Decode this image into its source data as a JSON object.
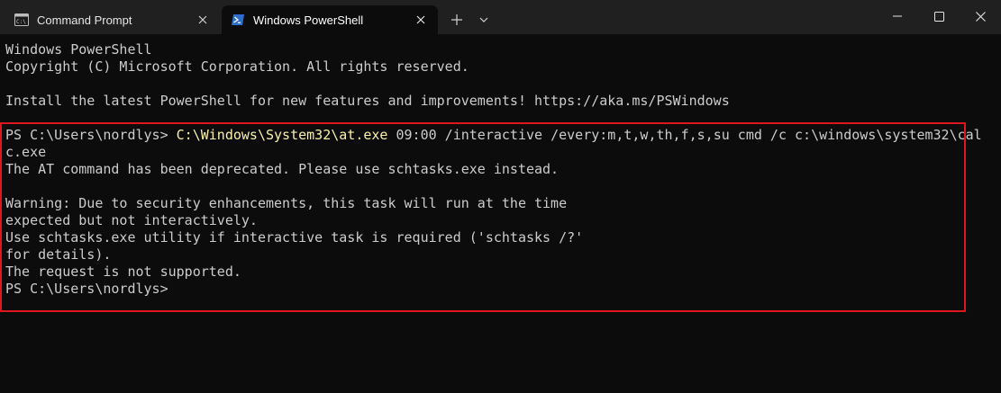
{
  "tabs": [
    {
      "label": "Command Prompt",
      "icon": "cmd-icon",
      "active": false
    },
    {
      "label": "Windows PowerShell",
      "icon": "powershell-icon",
      "active": true
    }
  ],
  "window_controls": {
    "new_tab": "+",
    "dropdown": "⌄"
  },
  "terminal": {
    "header_lines": [
      "Windows PowerShell",
      "Copyright (C) Microsoft Corporation. All rights reserved.",
      "",
      "Install the latest PowerShell for new features and improvements! https://aka.ms/PSWindows",
      ""
    ],
    "command": {
      "prompt": "PS C:\\Users\\nordlys> ",
      "executable": "C:\\Windows\\System32\\at.exe",
      "args_line1": " 09:00 /interactive /every:m,t,w,th,f,s,su cmd /c c:\\windows\\system32\\cal",
      "args_line2": "c.exe"
    },
    "output_lines": [
      "The AT command has been deprecated. Please use schtasks.exe instead.",
      "",
      "Warning: Due to security enhancements, this task will run at the time",
      "expected but not interactively.",
      "Use schtasks.exe utility if interactive task is required ('schtasks /?'",
      "for details).",
      "The request is not supported.",
      "PS C:\\Users\\nordlys>"
    ]
  },
  "colors": {
    "background": "#0c0c0c",
    "titlebar": "#202020",
    "text": "#cccccc",
    "command_highlight": "#f9f1a5",
    "annotation_border": "#e0161f"
  }
}
